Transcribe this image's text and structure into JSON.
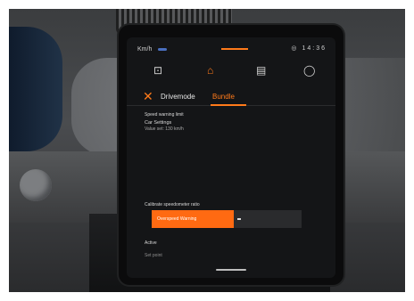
{
  "status_bar": {
    "left_text": "Km/h",
    "right_icons": "◎ 14:36"
  },
  "nav": {
    "icons": [
      "media-icon",
      "car-icon",
      "settings-icon",
      "profile-icon"
    ],
    "glyphs": [
      "⊡",
      "⌂",
      "▤",
      "◯"
    ]
  },
  "tabs": {
    "close_glyph": "✕",
    "tab1": "Drivemode",
    "tab2": "Bundle"
  },
  "content": {
    "section_label": "Speed warning limit",
    "item_title": "Car Settings",
    "item_sub": "Value set: 130 km/h",
    "slider_label": "Calibrate speedometer ratio",
    "slider_value_text": "Overspeed Warning",
    "slider_fraction": 0.55,
    "footer_label": "Active",
    "footer_sub": "Set point"
  },
  "colors": {
    "accent": "#ff6a12",
    "screen_bg": "#141517"
  }
}
